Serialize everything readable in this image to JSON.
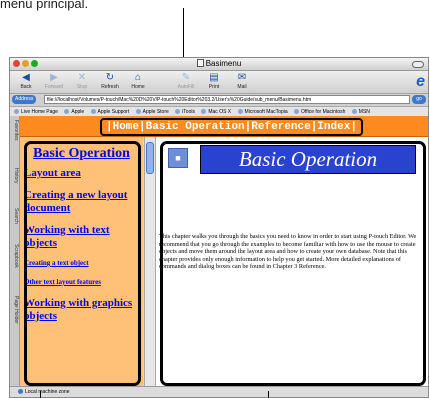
{
  "caption": "menu principal.",
  "window": {
    "title": "Basimenu"
  },
  "toolbar": {
    "buttons": [
      {
        "label": "Back",
        "icon": "◀"
      },
      {
        "label": "Forward",
        "icon": "▶"
      },
      {
        "label": "Stop",
        "icon": "✕"
      },
      {
        "label": "Refresh",
        "icon": "↻"
      },
      {
        "label": "Home",
        "icon": "⌂"
      },
      {
        "label": "AutoFill",
        "icon": "✎"
      },
      {
        "label": "Print",
        "icon": "▤"
      },
      {
        "label": "Mail",
        "icon": "✉"
      }
    ],
    "ie_logo": "e"
  },
  "address": {
    "label": "Address",
    "value": "file:///localhost/Volumes/P-touch/Mac%20D%20V/P-touch%20Editor%203.2/User's%20Guide/sub_menu/Basimenu.htm",
    "go": "go"
  },
  "favorites": [
    "Live Home Page",
    "Apple",
    "Apple Support",
    "Apple Store",
    "iTools",
    "Mac OS X",
    "Microsoft MacTopia",
    "Office for Macintosh",
    "MSN"
  ],
  "sidetabs": [
    "Favorites",
    "History",
    "Search",
    "Scrapbook",
    "Page Holder"
  ],
  "topnav": {
    "home": "Home",
    "basic": "Basic Operation",
    "reference": "Reference",
    "index": "Index"
  },
  "leftnav": {
    "title": "Basic Operation",
    "links": [
      {
        "label": "Layout area",
        "size": "big"
      },
      {
        "label": "Creating a new layout document",
        "size": "big"
      },
      {
        "label": "Working with text objects",
        "size": "big"
      },
      {
        "label": "Creating a text object",
        "size": "small"
      },
      {
        "label": "Other text layout features",
        "size": "small"
      },
      {
        "label": "Working with graphics objects",
        "size": "big"
      }
    ]
  },
  "main": {
    "heading": "Basic Operation",
    "body": "This chapter walks you through the basics you need to know in order to start using P-touch Editor. We recommend that you go through the examples to become familiar with how to use the mouse to create objects and move them around the layout area and how to create your own database. Note that this chapter provides only enough information to help you get started. More detailed explanations of commands and dialog boxes can be found in Chapter 3 Reference."
  },
  "status": "Local machine zone",
  "colors": {
    "frame_orange": "#ff8a1f",
    "nav_bg": "#ffc078",
    "heading_blue": "#2a43cf",
    "link_blue": "#0000ee"
  }
}
